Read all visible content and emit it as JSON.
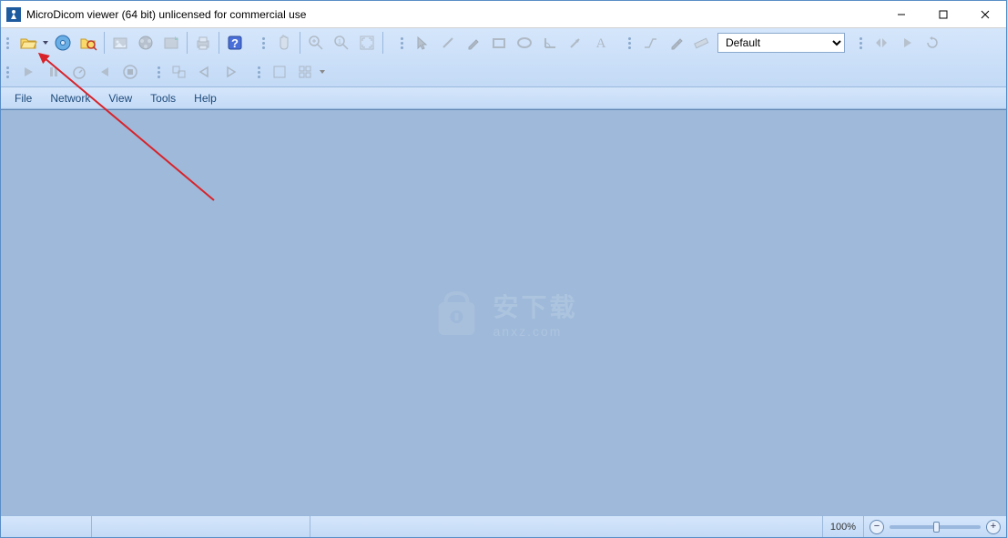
{
  "window": {
    "title": "MicroDicom viewer (64 bit) unlicensed for commercial use"
  },
  "menu": {
    "file": "File",
    "network": "Network",
    "view": "View",
    "tools": "Tools",
    "help": "Help"
  },
  "dropdown": {
    "preset_selected": "Default"
  },
  "status": {
    "zoom_label": "100%"
  },
  "watermark": {
    "line1": "安下载",
    "line2": "anxz.com"
  }
}
